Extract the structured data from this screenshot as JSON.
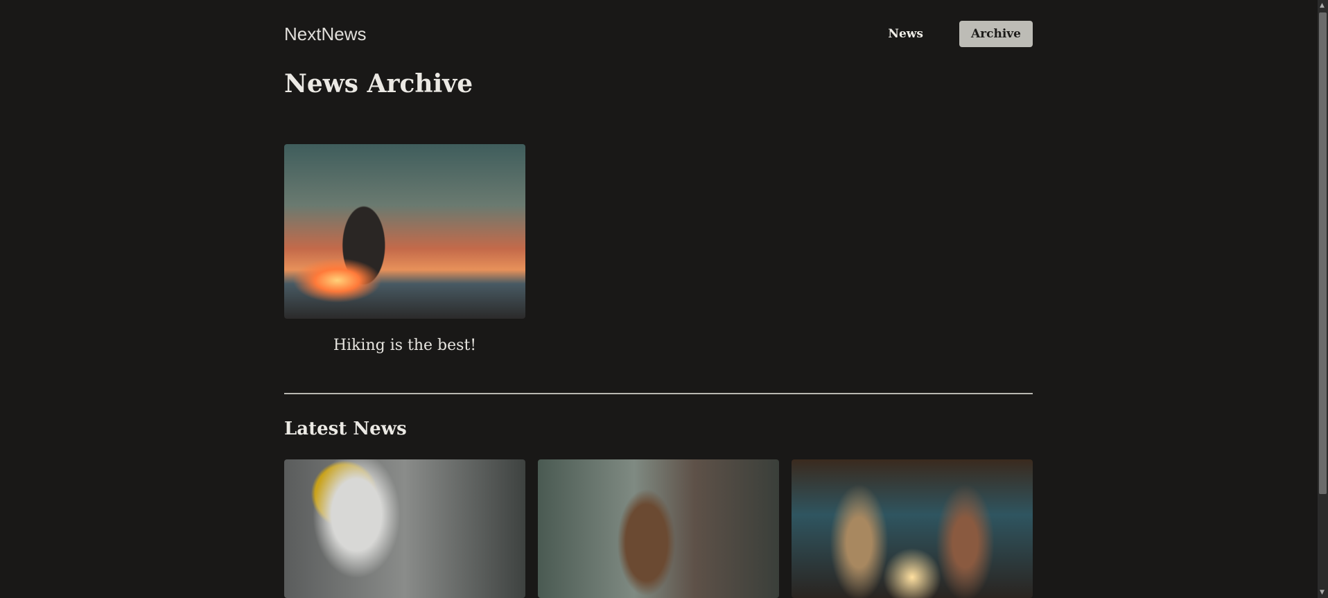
{
  "header": {
    "logo": "NextNews",
    "nav": [
      {
        "label": "News",
        "active": false
      },
      {
        "label": "Archive",
        "active": true
      }
    ]
  },
  "archive": {
    "title": "News Archive",
    "items": [
      {
        "caption": "Hiking is the best!",
        "image": "hiker-at-sunset"
      }
    ]
  },
  "latest": {
    "title": "Latest News",
    "items": [
      {
        "image": "robot-with-tablet"
      },
      {
        "image": "beaver-on-tree"
      },
      {
        "image": "couple-cooking"
      }
    ]
  },
  "colors": {
    "background": "#191817",
    "active_nav": "#bdbcb6",
    "divider": "#b9b8b2"
  }
}
